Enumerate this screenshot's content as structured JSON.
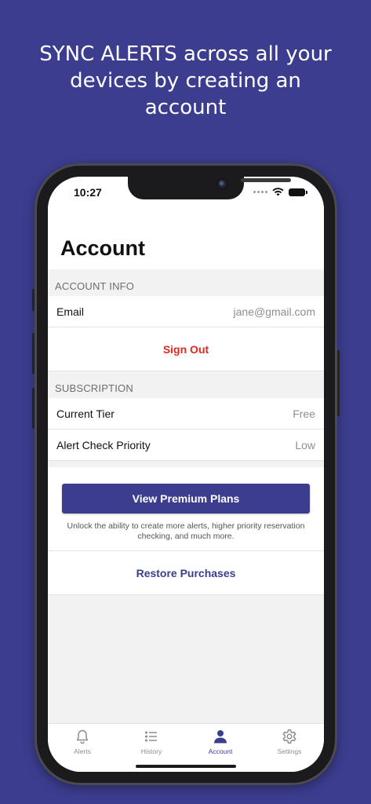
{
  "promo": {
    "headline": "SYNC ALERTS across all your devices by creating an account"
  },
  "status_bar": {
    "time": "10:27"
  },
  "page": {
    "title": "Account"
  },
  "account_info": {
    "section_label": "ACCOUNT INFO",
    "email_label": "Email",
    "email_value": "jane@gmail.com",
    "sign_out_label": "Sign Out"
  },
  "subscription": {
    "section_label": "SUBSCRIPTION",
    "tier_label": "Current Tier",
    "tier_value": "Free",
    "priority_label": "Alert Check Priority",
    "priority_value": "Low",
    "premium_button": "View Premium Plans",
    "premium_note": "Unlock the ability to create more alerts, higher priority reservation checking, and much more.",
    "restore_label": "Restore Purchases"
  },
  "tabs": [
    {
      "label": "Alerts",
      "icon": "bell-icon"
    },
    {
      "label": "History",
      "icon": "list-icon"
    },
    {
      "label": "Account",
      "icon": "person-icon"
    },
    {
      "label": "Settings",
      "icon": "gear-icon"
    }
  ],
  "colors": {
    "brand": "#3c3d8f",
    "destructive": "#e0281c"
  }
}
